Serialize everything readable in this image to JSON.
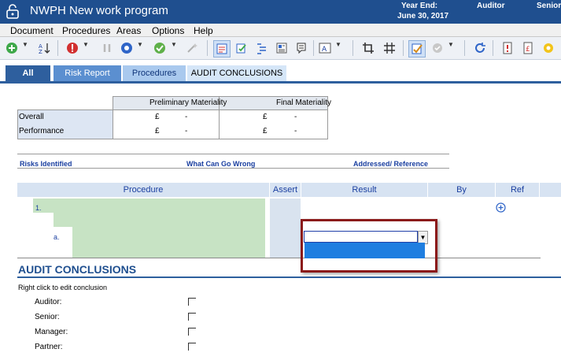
{
  "titlebar": {
    "title": "NWPH New work program",
    "year_end_label": "Year End:",
    "year_end_date": "June 30, 2017",
    "roles": [
      "Auditor",
      "Senior"
    ],
    "bg_color": "#1f4f8f"
  },
  "menu": [
    "Document",
    "Procedures",
    "Areas",
    "Options",
    "Help"
  ],
  "toolbar": {
    "icons": [
      "add-icon",
      "sort-az-icon",
      "stop-icon",
      "pause-icon",
      "record-icon",
      "check-icon",
      "wand-icon",
      "form-icon",
      "edit-check-icon",
      "list-icon",
      "document-icon",
      "note-icon",
      "text-format-icon",
      "crop-icon",
      "grid-icon",
      "signoff-icon",
      "stamp-icon",
      "refresh-icon",
      "report-icon",
      "currency-icon",
      "settings-icon"
    ]
  },
  "tabs": [
    {
      "label": "All"
    },
    {
      "label": "Risk Report"
    },
    {
      "label": "Procedures"
    },
    {
      "label": "AUDIT CONCLUSIONS"
    }
  ],
  "materiality": {
    "col_preliminary": "Preliminary Materiality",
    "col_final": "Final Materiality",
    "rows": [
      {
        "label": "Overall",
        "prelim_currency": "£",
        "prelim_value": "-",
        "final_currency": "£",
        "final_value": "-"
      },
      {
        "label": "Performance",
        "prelim_currency": "£",
        "prelim_value": "-",
        "final_currency": "£",
        "final_value": "-"
      }
    ]
  },
  "risks": {
    "col_identified": "Risks Identified",
    "col_wrong": "What Can Go Wrong",
    "col_addressed": "Addressed/  Reference"
  },
  "procedure_table": {
    "headers": {
      "procedure": "Procedure",
      "assert": "Assert",
      "result": "Result",
      "by": "By",
      "ref": "Ref"
    },
    "item_number": "1.",
    "sub_item": "a.",
    "result_value": "",
    "add_icon": "plus-circle-icon"
  },
  "audit_conclusions": {
    "title": "AUDIT CONCLUSIONS",
    "hint": "Right click to edit conclusion",
    "signoffs": [
      {
        "label": "Auditor:",
        "checked": false
      },
      {
        "label": "Senior:",
        "checked": false
      },
      {
        "label": "Manager:",
        "checked": false
      },
      {
        "label": "Partner:",
        "checked": false
      }
    ]
  }
}
